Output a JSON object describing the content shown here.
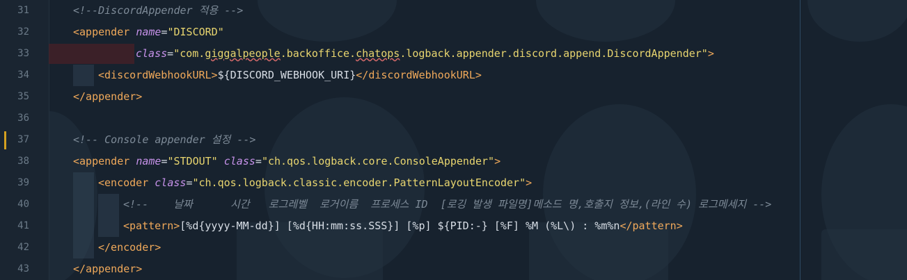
{
  "editor": {
    "lines": [
      {
        "num": "31",
        "parts": [
          {
            "cls": "c",
            "text": "<!--DiscordAppender 적용 -->"
          }
        ]
      },
      {
        "num": "32",
        "parts": [
          {
            "cls": "t",
            "text": "<appender "
          },
          {
            "cls": "a",
            "text": "name"
          },
          {
            "cls": "p",
            "text": "="
          },
          {
            "cls": "s",
            "text": "\"DISCORD\""
          }
        ]
      },
      {
        "num": "33",
        "parts": [
          {
            "cls": "a",
            "text": "class"
          },
          {
            "cls": "p",
            "text": "="
          },
          {
            "cls": "s",
            "text": "\"com."
          },
          {
            "cls": "s u",
            "text": "giggalpeople"
          },
          {
            "cls": "s",
            "text": ".backoffice."
          },
          {
            "cls": "s u",
            "text": "chatops"
          },
          {
            "cls": "s",
            "text": ".logback.appender.discord.append.DiscordAppender\""
          },
          {
            "cls": "t",
            "text": ">"
          }
        ]
      },
      {
        "num": "34",
        "parts": [
          {
            "cls": "t",
            "text": "<discordWebhookURL>"
          },
          {
            "cls": "p",
            "text": "${DISCORD_WEBHOOK_URI}"
          },
          {
            "cls": "t",
            "text": "</discordWebhookURL>"
          }
        ]
      },
      {
        "num": "35",
        "parts": [
          {
            "cls": "t",
            "text": "</appender>"
          }
        ]
      },
      {
        "num": "36",
        "parts": []
      },
      {
        "num": "37",
        "parts": [
          {
            "cls": "c",
            "text": "<!-- Console appender 설정 -->"
          }
        ]
      },
      {
        "num": "38",
        "parts": [
          {
            "cls": "t",
            "text": "<appender "
          },
          {
            "cls": "a",
            "text": "name"
          },
          {
            "cls": "p",
            "text": "="
          },
          {
            "cls": "s",
            "text": "\"STDOUT\" "
          },
          {
            "cls": "a",
            "text": "class"
          },
          {
            "cls": "p",
            "text": "="
          },
          {
            "cls": "s",
            "text": "\"ch.qos.logback.core.ConsoleAppender\""
          },
          {
            "cls": "t",
            "text": ">"
          }
        ]
      },
      {
        "num": "39",
        "parts": [
          {
            "cls": "t",
            "text": "<encoder "
          },
          {
            "cls": "a",
            "text": "class"
          },
          {
            "cls": "p",
            "text": "="
          },
          {
            "cls": "s",
            "text": "\"ch.qos.logback.classic.encoder.PatternLayoutEncoder\""
          },
          {
            "cls": "t",
            "text": ">"
          }
        ]
      },
      {
        "num": "40",
        "parts": [
          {
            "cls": "c",
            "text": "<!--    날짜      시간   로그레벨  로거이름  프로세스 ID  [로깅 발생 파일명]메소드 명,호출지 정보,(라인 수) 로그메세지 -->"
          }
        ]
      },
      {
        "num": "41",
        "parts": [
          {
            "cls": "t",
            "text": "<pattern>"
          },
          {
            "cls": "p",
            "text": "[%d{yyyy-MM-dd}] [%d{HH:mm:ss.SSS}] [%p] ${PID:-} [%F] %M (%L\\) : %m%n"
          },
          {
            "cls": "t",
            "text": "</pattern>"
          }
        ]
      },
      {
        "num": "42",
        "parts": [
          {
            "cls": "t",
            "text": "</encoder>"
          }
        ]
      },
      {
        "num": "43",
        "parts": [
          {
            "cls": "t",
            "text": "</appender>"
          }
        ]
      }
    ]
  }
}
